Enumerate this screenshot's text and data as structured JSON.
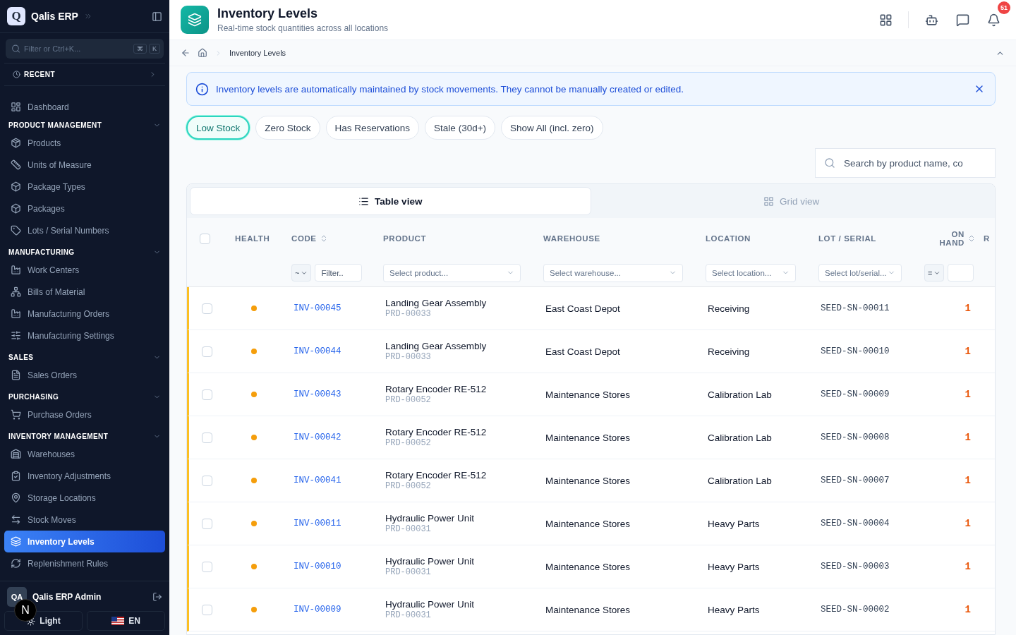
{
  "sidebar": {
    "brand_mark": "Q",
    "brand": "Qalis ERP",
    "search": {
      "placeholder": "Filter or Ctrl+K...",
      "shortcut": [
        "⌘",
        "K"
      ]
    },
    "recent": "RECENT",
    "items": [
      {
        "label": "Dashboard",
        "selected": false
      }
    ],
    "sections": [
      {
        "title": "PRODUCT MANAGEMENT",
        "expanded": true,
        "items": [
          {
            "label": "Products",
            "selected": false
          },
          {
            "label": "Units of Measure",
            "selected": false
          },
          {
            "label": "Package Types",
            "selected": false
          },
          {
            "label": "Packages",
            "selected": false
          },
          {
            "label": "Lots / Serial Numbers",
            "selected": false
          }
        ]
      },
      {
        "title": "MANUFACTURING",
        "expanded": true,
        "items": [
          {
            "label": "Work Centers",
            "selected": false
          },
          {
            "label": "Bills of Material",
            "selected": false
          },
          {
            "label": "Manufacturing Orders",
            "selected": false
          },
          {
            "label": "Manufacturing Settings",
            "selected": false
          }
        ]
      },
      {
        "title": "SALES",
        "expanded": true,
        "items": [
          {
            "label": "Sales Orders",
            "selected": false
          }
        ]
      },
      {
        "title": "PURCHASING",
        "expanded": true,
        "items": [
          {
            "label": "Purchase Orders",
            "selected": false
          }
        ]
      },
      {
        "title": "INVENTORY MANAGEMENT",
        "expanded": true,
        "items": [
          {
            "label": "Warehouses",
            "selected": false
          },
          {
            "label": "Inventory Adjustments",
            "selected": false
          },
          {
            "label": "Storage Locations",
            "selected": false
          },
          {
            "label": "Stock Moves",
            "selected": false
          },
          {
            "label": "Inventory Levels",
            "selected": true
          },
          {
            "label": "Replenishment Rules",
            "selected": false
          }
        ]
      }
    ],
    "user": {
      "initials": "QA",
      "name": "Qalis ERP Admin"
    },
    "dev_badge": "N",
    "theme_button": "Light",
    "language_button": "EN"
  },
  "header": {
    "title": "Inventory Levels",
    "subtitle": "Real-time stock quantities across all locations",
    "notification_count": "51"
  },
  "breadcrumb": {
    "current": "Inventory Levels"
  },
  "alert": {
    "text": "Inventory levels are automatically maintained by stock movements. They cannot be manually created or edited."
  },
  "quick_filters": [
    {
      "label": "Low Stock",
      "selected": true
    },
    {
      "label": "Zero Stock",
      "selected": false
    },
    {
      "label": "Has Reservations",
      "selected": false
    },
    {
      "label": "Stale (30d+)",
      "selected": false
    },
    {
      "label": "Show All (incl. zero)",
      "selected": false
    }
  ],
  "search": {
    "placeholder": "Search by product name, co"
  },
  "view_toggle": [
    {
      "label": "Table view",
      "selected": true
    },
    {
      "label": "Grid view",
      "selected": false
    }
  ],
  "table": {
    "select_all_checked": false,
    "columns": [
      {
        "label": "HEALTH",
        "sortable": false
      },
      {
        "label": "CODE",
        "sortable": true
      },
      {
        "label": "PRODUCT",
        "sortable": false
      },
      {
        "label": "WAREHOUSE",
        "sortable": false
      },
      {
        "label": "LOCATION",
        "sortable": false
      },
      {
        "label": "LOT / SERIAL",
        "sortable": false
      },
      {
        "label": "ON HAND",
        "sortable": true
      },
      {
        "label": "R"
      }
    ],
    "filters": [
      {
        "kind": "none"
      },
      {
        "kind": "text",
        "operator": "~",
        "placeholder": "Filter.."
      },
      {
        "kind": "select",
        "placeholder": "Select product..."
      },
      {
        "kind": "select",
        "placeholder": "Select warehouse..."
      },
      {
        "kind": "select",
        "placeholder": "Select location..."
      },
      {
        "kind": "select",
        "placeholder": "Select lot/serial..."
      },
      {
        "kind": "number",
        "operator": "="
      },
      {
        "kind": "none"
      }
    ],
    "rows": [
      {
        "checked": false,
        "code": "INV-00045",
        "product": "Landing Gear Assembly",
        "product_code": "PRD-00033",
        "warehouse": "East Coast Depot",
        "location": "Receiving",
        "lot": "SEED-SN-00011",
        "on_hand": "1"
      },
      {
        "checked": false,
        "code": "INV-00044",
        "product": "Landing Gear Assembly",
        "product_code": "PRD-00033",
        "warehouse": "East Coast Depot",
        "location": "Receiving",
        "lot": "SEED-SN-00010",
        "on_hand": "1"
      },
      {
        "checked": false,
        "code": "INV-00043",
        "product": "Rotary Encoder RE-512",
        "product_code": "PRD-00052",
        "warehouse": "Maintenance Stores",
        "location": "Calibration Lab",
        "lot": "SEED-SN-00009",
        "on_hand": "1"
      },
      {
        "checked": false,
        "code": "INV-00042",
        "product": "Rotary Encoder RE-512",
        "product_code": "PRD-00052",
        "warehouse": "Maintenance Stores",
        "location": "Calibration Lab",
        "lot": "SEED-SN-00008",
        "on_hand": "1"
      },
      {
        "checked": false,
        "code": "INV-00041",
        "product": "Rotary Encoder RE-512",
        "product_code": "PRD-00052",
        "warehouse": "Maintenance Stores",
        "location": "Calibration Lab",
        "lot": "SEED-SN-00007",
        "on_hand": "1"
      },
      {
        "checked": false,
        "code": "INV-00011",
        "product": "Hydraulic Power Unit",
        "product_code": "PRD-00031",
        "warehouse": "Maintenance Stores",
        "location": "Heavy Parts",
        "lot": "SEED-SN-00004",
        "on_hand": "1"
      },
      {
        "checked": false,
        "code": "INV-00010",
        "product": "Hydraulic Power Unit",
        "product_code": "PRD-00031",
        "warehouse": "Maintenance Stores",
        "location": "Heavy Parts",
        "lot": "SEED-SN-00003",
        "on_hand": "1"
      },
      {
        "checked": false,
        "code": "INV-00009",
        "product": "Hydraulic Power Unit",
        "product_code": "PRD-00031",
        "warehouse": "Maintenance Stores",
        "location": "Heavy Parts",
        "lot": "SEED-SN-00002",
        "on_hand": "1"
      }
    ]
  }
}
